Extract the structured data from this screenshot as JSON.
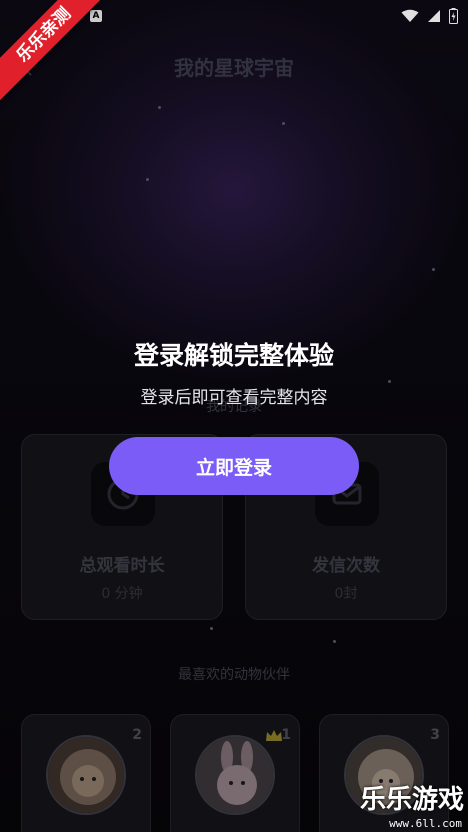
{
  "watermark": {
    "ribbon": "乐乐亲测",
    "brand": "乐乐游戏",
    "url": "www.6ll.com"
  },
  "status_bar": {
    "notification_badge": "A"
  },
  "header": {
    "title": "我的星球宇宙"
  },
  "records_label": "我的记录",
  "stats": [
    {
      "label": "总观看时长",
      "value": "0 分钟",
      "icon": "clock-icon"
    },
    {
      "label": "发信次数",
      "value": "0封",
      "icon": "mail-icon"
    }
  ],
  "favorites": {
    "label": "最喜欢的动物伙伴",
    "items": [
      {
        "rank": "2",
        "icon": "sheep-avatar"
      },
      {
        "rank": "1",
        "icon": "rabbit-avatar",
        "crown": true
      },
      {
        "rank": "3",
        "icon": "sheep-avatar"
      }
    ]
  },
  "login_prompt": {
    "title": "登录解锁完整体验",
    "subtitle": "登录后即可查看完整内容",
    "button": "立即登录"
  },
  "colors": {
    "accent": "#7c5cf6",
    "ribbon": "#e0202b",
    "background": "#08060c"
  }
}
